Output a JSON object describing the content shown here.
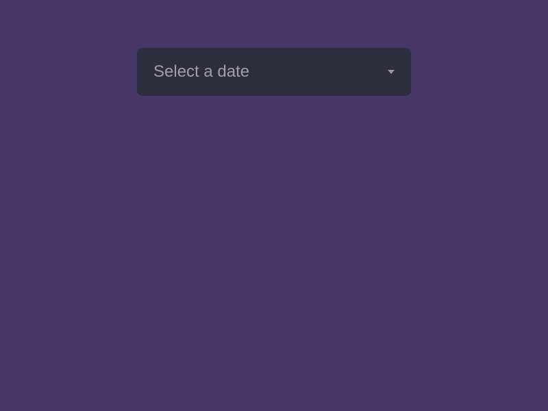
{
  "select": {
    "placeholder": "Select a date"
  }
}
